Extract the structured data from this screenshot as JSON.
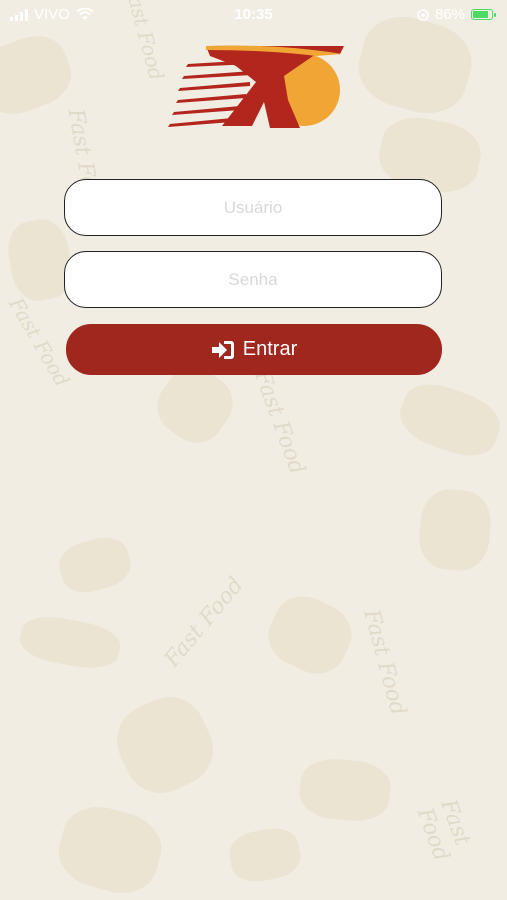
{
  "status_bar": {
    "carrier": "VIVO",
    "time": "10:35",
    "battery_percent_label": "86%",
    "battery_level": 0.86
  },
  "logo": {
    "icon": "brand-logo",
    "colors": {
      "red": "#b3261e",
      "orange": "#f0a535"
    }
  },
  "login": {
    "username_placeholder": "Usuário",
    "password_placeholder": "Senha",
    "submit_label": "Entrar",
    "submit_icon": "sign-in-icon",
    "accent_color": "#a0271e"
  },
  "background": {
    "pattern": "fast-food doodles",
    "decor_texts": [
      "Fast Food",
      "Fast Food",
      "Fast Food",
      "Fast Food",
      "Fast Food",
      "Fast Food",
      "Fast Food"
    ]
  }
}
